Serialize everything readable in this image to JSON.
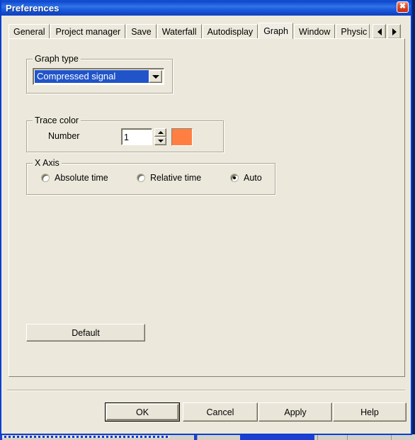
{
  "window": {
    "title": "Preferences",
    "close_label": "✖"
  },
  "tabs": {
    "items": [
      {
        "label": "General",
        "active": false
      },
      {
        "label": "Project manager",
        "active": false
      },
      {
        "label": "Save",
        "active": false
      },
      {
        "label": "Waterfall",
        "active": false
      },
      {
        "label": "Autodisplay",
        "active": false
      },
      {
        "label": "Graph",
        "active": true
      },
      {
        "label": "Window",
        "active": false
      },
      {
        "label": "Physic",
        "active": false
      }
    ],
    "scroll_left_icon": "left-arrow-icon",
    "scroll_right_icon": "right-arrow-icon"
  },
  "graph_type": {
    "group_title": "Graph type",
    "selected": "Compressed signal",
    "dropdown_icon": "chevron-down-icon"
  },
  "trace_color": {
    "group_title": "Trace color",
    "number_label": "Number",
    "number_value": "1",
    "spin_up_icon": "up-arrow-icon",
    "spin_down_icon": "down-arrow-icon",
    "swatch_color": "#FF7F43"
  },
  "x_axis": {
    "group_title": "X Axis",
    "options": [
      {
        "label": "Absolute time",
        "checked": false
      },
      {
        "label": "Relative time",
        "checked": false
      },
      {
        "label": "Auto",
        "checked": true
      }
    ]
  },
  "panel_buttons": {
    "default_label": "Default"
  },
  "footer_buttons": {
    "ok_label": "OK",
    "cancel_label": "Cancel",
    "apply_label": "Apply",
    "help_label": "Help"
  },
  "colors": {
    "dialog_background": "#ECE9DC",
    "title_blue": "#1E5FE0",
    "window_border_blue": "#0A3FD0",
    "combo_highlight": "#2154C8",
    "trace_swatch": "#FF7F43"
  }
}
